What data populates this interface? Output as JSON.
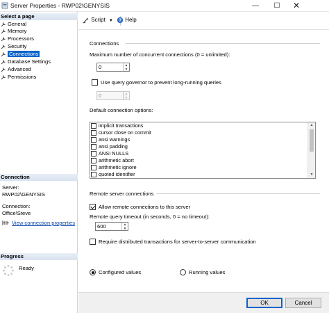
{
  "window": {
    "title": "Server Properties - RWP02\\GENYSIS",
    "minimize": "—",
    "maximize": "☐",
    "close": "✕"
  },
  "left": {
    "select_page_header": "Select a page",
    "pages": [
      {
        "label": "General",
        "selected": false
      },
      {
        "label": "Memory",
        "selected": false
      },
      {
        "label": "Processors",
        "selected": false
      },
      {
        "label": "Security",
        "selected": false
      },
      {
        "label": "Connections",
        "selected": true
      },
      {
        "label": "Database Settings",
        "selected": false
      },
      {
        "label": "Advanced",
        "selected": false
      },
      {
        "label": "Permissions",
        "selected": false
      }
    ],
    "connection_header": "Connection",
    "server_label": "Server:",
    "server_value": "RWP02\\GENYSIS",
    "connection_label": "Connection:",
    "connection_value": "Office\\Steve",
    "view_properties_link": "View connection properties",
    "progress_header": "Progress",
    "progress_status": "Ready"
  },
  "toolbar": {
    "script_label": "Script",
    "help_label": "Help"
  },
  "connections": {
    "group_label": "Connections",
    "max_concurrent_label": "Maximum number of concurrent connections (0 = unlimited):",
    "max_concurrent_value": "0",
    "query_governor_label": "Use query governor to prevent long-running queries",
    "query_governor_checked": false,
    "query_governor_value": "0",
    "default_options_label": "Default connection options:",
    "default_options": [
      {
        "label": "implicit transactions",
        "checked": false
      },
      {
        "label": "cursor close on commit",
        "checked": false
      },
      {
        "label": "ansi warnings",
        "checked": false
      },
      {
        "label": "ansi padding",
        "checked": false
      },
      {
        "label": "ANSI NULLS",
        "checked": false
      },
      {
        "label": "arithmetic abort",
        "checked": false
      },
      {
        "label": "arithmetic ignore",
        "checked": false
      },
      {
        "label": "quoted identifier",
        "checked": false
      }
    ]
  },
  "remote": {
    "group_label": "Remote server connections",
    "allow_remote_label": "Allow remote connections to this server",
    "allow_remote_checked": true,
    "timeout_label": "Remote query timeout (in seconds, 0 = no timeout):",
    "timeout_value": "600",
    "distributed_label": "Require distributed transactions for server-to-server communication",
    "distributed_checked": false
  },
  "values_mode": {
    "configured_label": "Configured values",
    "running_label": "Running values",
    "selected": "configured"
  },
  "buttons": {
    "ok_label": "OK",
    "cancel_label": "Cancel"
  },
  "colors": {
    "selection": "#0a63c9",
    "link": "#0645ad"
  }
}
